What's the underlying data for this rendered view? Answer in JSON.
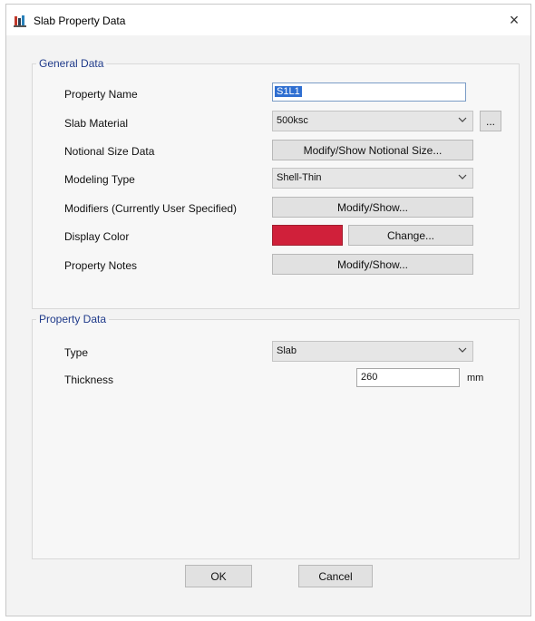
{
  "window": {
    "title": "Slab Property Data",
    "close_label": "×"
  },
  "general": {
    "legend": "General Data",
    "property_name": {
      "label": "Property Name",
      "value": "S1L1"
    },
    "slab_material": {
      "label": "Slab Material",
      "value": "500ksc",
      "more_label": "..."
    },
    "notional_size": {
      "label": "Notional Size Data",
      "button": "Modify/Show Notional Size..."
    },
    "modeling_type": {
      "label": "Modeling Type",
      "value": "Shell-Thin"
    },
    "modifiers": {
      "label": "Modifiers (Currently User Specified)",
      "button": "Modify/Show..."
    },
    "display_color": {
      "label": "Display Color",
      "color": "#d0203a",
      "button": "Change..."
    },
    "property_notes": {
      "label": "Property Notes",
      "button": "Modify/Show..."
    }
  },
  "property": {
    "legend": "Property Data",
    "type": {
      "label": "Type",
      "value": "Slab"
    },
    "thickness": {
      "label": "Thickness",
      "value": "260",
      "unit": "mm"
    }
  },
  "footer": {
    "ok_label": "OK",
    "cancel_label": "Cancel"
  }
}
